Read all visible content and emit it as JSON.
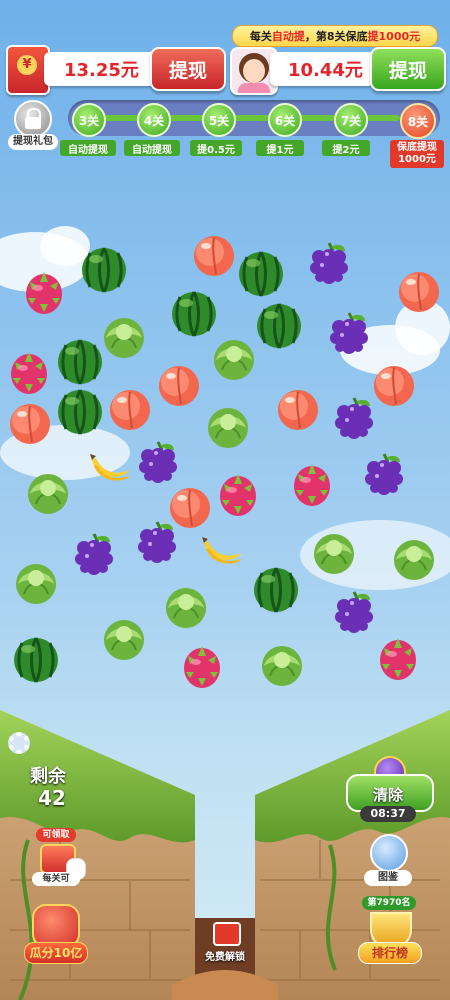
{
  "header": {
    "left_balance": "13.25元",
    "left_withdraw": "提现",
    "right_balance": "10.44元",
    "right_withdraw": "提现",
    "banner_pre": "每关",
    "banner_hl1": "自动提",
    "banner_mid": "，第8关保底",
    "banner_hl2": "提1000元",
    "gift_label": "提现礼包"
  },
  "progress": {
    "levels": [
      "3关",
      "4关",
      "5关",
      "6关",
      "7关",
      "8关"
    ],
    "labels": [
      "自动提现",
      "自动提现",
      "提0.5元",
      "提1元",
      "提2元"
    ],
    "final_label_line1": "保底提现",
    "final_label_line2": "1000元"
  },
  "board": {
    "fruits": [
      {
        "type": "dragonfruit"
      },
      {
        "type": "watermelon"
      },
      {
        "type": "peach"
      },
      {
        "type": "watermelon"
      },
      {
        "type": "grape"
      },
      {
        "type": "peach"
      },
      {
        "type": "cabbage"
      },
      {
        "type": "watermelon"
      },
      {
        "type": "watermelon"
      },
      {
        "type": "grape"
      },
      {
        "type": "dragonfruit"
      },
      {
        "type": "watermelon"
      },
      {
        "type": "cabbage"
      },
      {
        "type": "peach"
      },
      {
        "type": "peach"
      },
      {
        "type": "peach"
      },
      {
        "type": "watermelon"
      },
      {
        "type": "peach"
      },
      {
        "type": "cabbage"
      },
      {
        "type": "peach"
      },
      {
        "type": "grape"
      },
      {
        "type": "banana"
      },
      {
        "type": "grape"
      },
      {
        "type": "cabbage"
      },
      {
        "type": "dragonfruit"
      },
      {
        "type": "dragonfruit"
      },
      {
        "type": "grape"
      },
      {
        "type": "peach"
      },
      {
        "type": "grape"
      },
      {
        "type": "grape"
      },
      {
        "type": "banana"
      },
      {
        "type": "cabbage"
      },
      {
        "type": "cabbage"
      },
      {
        "type": "cabbage"
      },
      {
        "type": "cabbage"
      },
      {
        "type": "watermelon"
      },
      {
        "type": "grape"
      },
      {
        "type": "cabbage"
      },
      {
        "type": "watermelon"
      },
      {
        "type": "dragonfruit"
      },
      {
        "type": "cabbage"
      },
      {
        "type": "dragonfruit"
      }
    ]
  },
  "bottom": {
    "remaining_label": "剩余",
    "remaining_count": "42",
    "clear_label": "清除",
    "timer": "08:37",
    "claimable_badge": "可领取",
    "per_level_label": "每关可",
    "album_label": "图鉴",
    "rank_badge": "第7970名",
    "rank_label": "排行榜",
    "split_label": "瓜分10亿",
    "free_unlock": "免费解锁"
  },
  "colors": {
    "withdraw_red": "#d0302c",
    "withdraw_green": "#3ea822",
    "value_red": "#e4262a"
  }
}
